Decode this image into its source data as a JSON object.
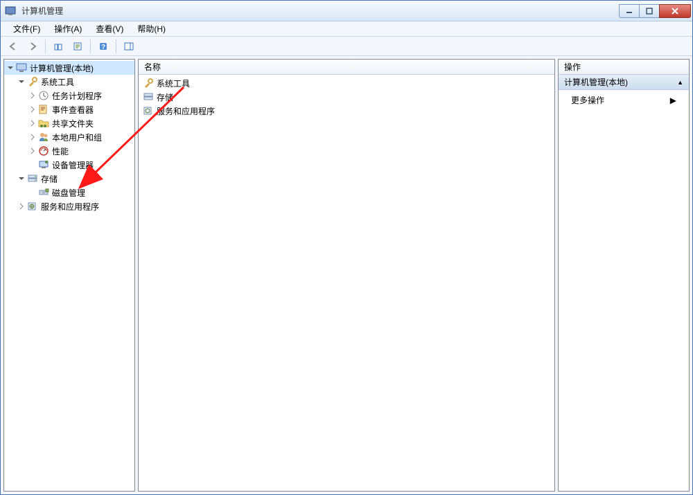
{
  "window": {
    "title": "计算机管理"
  },
  "menubar": {
    "file": "文件(F)",
    "action": "操作(A)",
    "view": "查看(V)",
    "help": "帮助(H)"
  },
  "tree": {
    "root": "计算机管理(本地)",
    "system_tools": "系统工具",
    "task_scheduler": "任务计划程序",
    "event_viewer": "事件查看器",
    "shared_folders": "共享文件夹",
    "local_users_groups": "本地用户和组",
    "performance": "性能",
    "device_manager": "设备管理器",
    "storage": "存储",
    "disk_management": "磁盘管理",
    "services_apps": "服务和应用程序"
  },
  "list": {
    "column_name": "名称",
    "items": {
      "system_tools": "系统工具",
      "storage": "存储",
      "services_apps": "服务和应用程序"
    }
  },
  "actions": {
    "header": "操作",
    "section_title": "计算机管理(本地)",
    "more_ops": "更多操作"
  }
}
